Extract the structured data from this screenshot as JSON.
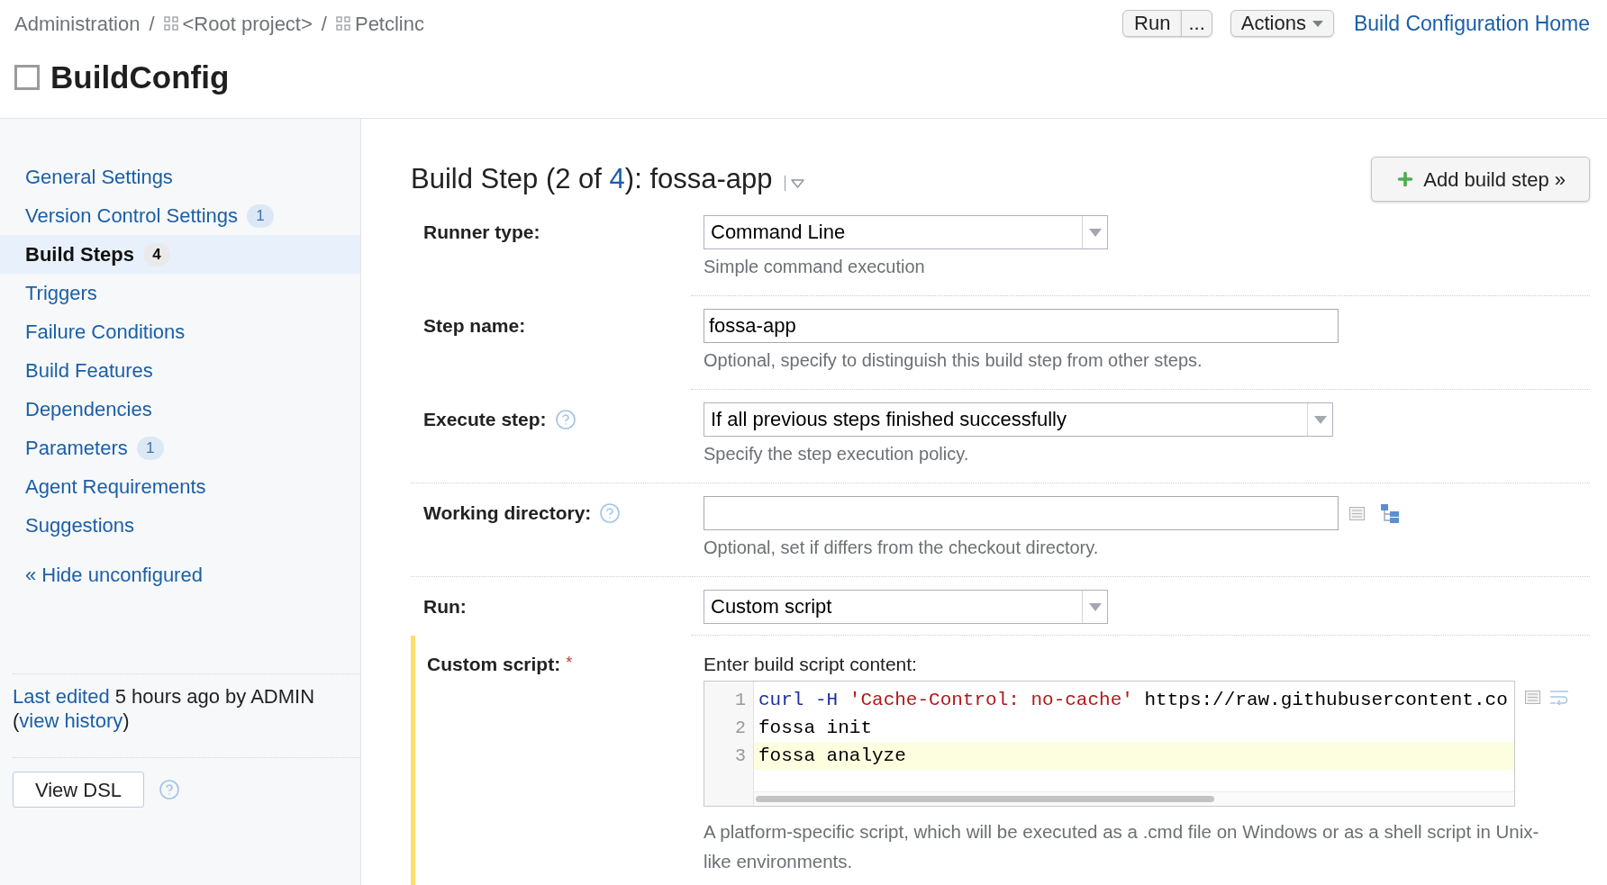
{
  "breadcrumbs": [
    {
      "kind": "text",
      "label": "Administration",
      "separator": "/"
    },
    {
      "kind": "project",
      "label": "<Root project>",
      "separator": "/"
    },
    {
      "kind": "project",
      "label": "Petclinc"
    }
  ],
  "title": "BuildConfig",
  "toolbar": {
    "run_button": "Run",
    "run_more_button": "...",
    "actions_button": "Actions",
    "home_link": "Build Configuration Home"
  },
  "sidebar": {
    "items": [
      {
        "label": "General Settings",
        "selected": false
      },
      {
        "label": "Version Control Settings",
        "badge": "1",
        "selected": false
      },
      {
        "label": "Build Steps",
        "badge": "4",
        "selected": true
      },
      {
        "label": "Triggers",
        "selected": false
      },
      {
        "label": "Failure Conditions",
        "selected": false
      },
      {
        "label": "Build Features",
        "selected": false
      },
      {
        "label": "Dependencies",
        "selected": false
      },
      {
        "label": "Parameters",
        "badge": "1",
        "selected": false
      },
      {
        "label": "Agent Requirements",
        "selected": false
      },
      {
        "label": "Suggestions",
        "selected": false
      }
    ],
    "toggle_link": "« Hide unconfigured",
    "last_edited": [
      {
        "kind": "link",
        "text": "Last edited"
      },
      {
        "kind": "text",
        "text": " 5 hours ago by ADMIN ("
      },
      {
        "kind": "link",
        "text": "view history"
      },
      {
        "kind": "text",
        "text": ")"
      }
    ],
    "view_dsl_button": "View DSL"
  },
  "step_heading": [
    {
      "kind": "text",
      "text": "Build Step (2 of "
    },
    {
      "kind": "link",
      "text": "4"
    },
    {
      "kind": "text",
      "text": "): fossa-app"
    }
  ],
  "add_step_button": "Add build step »",
  "form": {
    "rows": [
      {
        "kind": "select",
        "label": "Runner type:",
        "value": "Command Line",
        "hint": "Simple command execution"
      },
      {
        "kind": "text",
        "label": "Step name:",
        "value": "fossa-app",
        "hint": "Optional, specify to distinguish this build step from other steps."
      },
      {
        "kind": "select",
        "label": "Execute step:",
        "help": true,
        "value": "If all previous steps finished successfully",
        "hint": "Specify the step execution policy."
      },
      {
        "kind": "path",
        "label": "Working directory:",
        "help": true,
        "hint": "Optional, set if differs from the checkout directory."
      },
      {
        "kind": "select",
        "label": "Run:",
        "value": "Custom script"
      },
      {
        "kind": "script",
        "label": "Custom script:",
        "required_mark": "*",
        "intro": "Enter build script content:",
        "lines": [
          {
            "number": "1",
            "highlighted": false,
            "tokens": [
              {
                "kind": "keyword",
                "text": "curl -H"
              },
              {
                "kind": "string",
                "text": " 'Cache-Control: no-cache'"
              },
              {
                "kind": "plain",
                "text": " https://raw.githubusercontent.co"
              }
            ]
          },
          {
            "number": "2",
            "highlighted": false,
            "tokens": [
              {
                "kind": "plain",
                "text": "fossa init"
              }
            ]
          },
          {
            "number": "3",
            "highlighted": true,
            "tokens": [
              {
                "kind": "plain",
                "text": "fossa analyze"
              }
            ]
          }
        ],
        "hint": "A platform-specific script, which will be executed as a .cmd file on Windows or as a shell script in Unix-like environments."
      }
    ]
  }
}
